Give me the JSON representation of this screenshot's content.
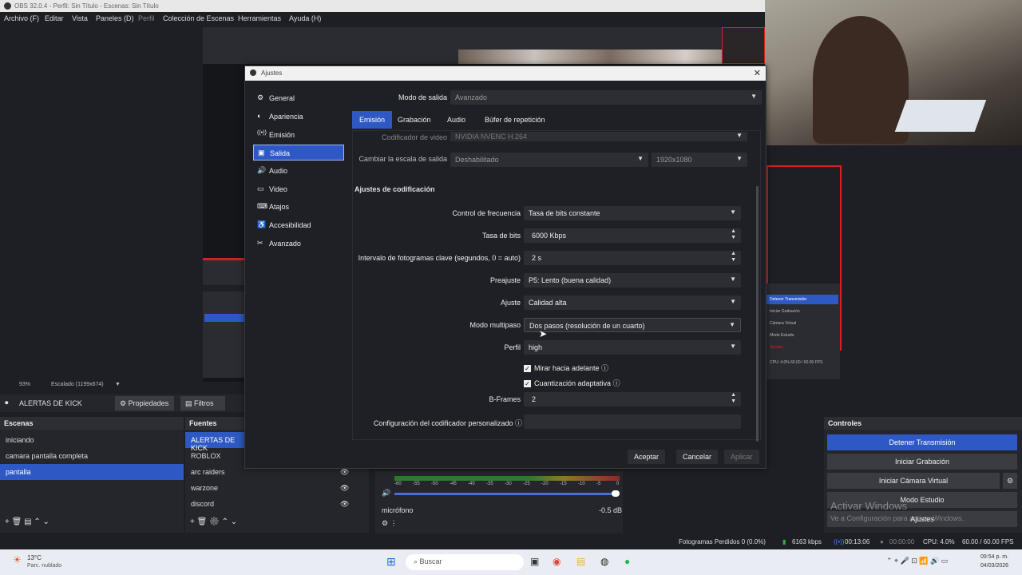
{
  "obs_window": {
    "title": "OBS 32.0.4 - Perfil: Sin Título - Escenas: Sin Título",
    "menu": [
      "Archivo (F)",
      "Editar",
      "Vista",
      "Paneles (D)",
      "Perfil",
      "Colección de Escenas",
      "Herramientas",
      "Ayuda (H)"
    ]
  },
  "preview_status": {
    "zoom": "93%",
    "scaling": "Escalado (1199x674)"
  },
  "source_toolbar": {
    "selected_source": "ALERTAS DE KICK",
    "properties": "Propiedades",
    "filters": "Filtros"
  },
  "scenes": {
    "title": "Escenas",
    "items": [
      "iniciando",
      "camara pantalla completa",
      "pantalla"
    ],
    "selected": 2
  },
  "sources": {
    "title": "Fuentes",
    "items": [
      "ALERTAS DE KICK",
      "ROBLOX",
      "arc raiders",
      "warzone",
      "discord"
    ]
  },
  "mixer": {
    "channel": "micrófono",
    "db": "-0.5 dB",
    "scale": [
      "-60",
      "-55",
      "-50",
      "-45",
      "-40",
      "-35",
      "-30",
      "-25",
      "-20",
      "-15",
      "-10",
      "-5",
      "0"
    ]
  },
  "controls": {
    "title": "Controles",
    "buttons": [
      "Detener Transmisión",
      "Iniciar Grabación",
      "Iniciar Cámara Virtual",
      "Modo Estudio",
      "Ajustes"
    ]
  },
  "watermark": {
    "line1": "Activar Windows",
    "line2": "Ve a Configuración para activar Windows."
  },
  "status_bar": {
    "dropped": "Fotogramas Perdidos 0 (0.0%)",
    "bitrate": "6163 kbps",
    "stream_time": "00:13:06",
    "rec_time": "00:00:00",
    "cpu": "CPU: 4.0%",
    "fps": "60.00 / 60.00 FPS"
  },
  "taskbar": {
    "weather_temp": "13°C",
    "weather_desc": "Parc. nublado",
    "search": "Buscar",
    "time": "09:54 p. m.",
    "date": "04/03/2026"
  },
  "nested_panel": {
    "items": [
      "Detener Transmisión",
      "Iniciar Grabación",
      "Cámara Virtual",
      "Modo Estudio",
      "Ajustes"
    ],
    "status": "CPU: 4.0%   60.00 / 60.00 FPS"
  },
  "settings": {
    "title": "Ajustes",
    "sidebar": [
      "General",
      "Apariencia",
      "Emisión",
      "Salida",
      "Audio",
      "Video",
      "Atajos",
      "Accesibilidad",
      "Avanzado"
    ],
    "sidebar_icons": [
      "⚙",
      "◐",
      "((•))",
      "▣",
      "🔊",
      "▭",
      "⌨",
      "♿",
      "✂"
    ],
    "selected": 3,
    "output_mode_label": "Modo de salida",
    "output_mode_value": "Avanzado",
    "tabs": [
      "Emisión",
      "Grabación",
      "Audio",
      "Búfer de repetición"
    ],
    "selected_tab": 0,
    "encoder_label": "Codificador de video",
    "encoder_value": "NVIDIA NVENC H.264",
    "rescale_label": "Cambiar la escala de salida",
    "rescale_value": "Deshabilitado",
    "rescale_res": "1920x1080",
    "section_title": "Ajustes de codificación",
    "rate_control_label": "Control de frecuencia",
    "rate_control_value": "Tasa de bits constante",
    "bitrate_label": "Tasa de bits",
    "bitrate_value": "6000 Kbps",
    "keyframe_label": "Intervalo de fotogramas clave (segundos, 0 = auto)",
    "keyframe_value": "2 s",
    "preset_label": "Preajuste",
    "preset_value": "P5: Lento (buena calidad)",
    "tuning_label": "Ajuste",
    "tuning_value": "Calidad alta",
    "multipass_label": "Modo multipaso",
    "multipass_value": "Dos pasos (resolución de un cuarto)",
    "profile_label": "Perfil",
    "profile_value": "high",
    "lookahead_label": "Mirar hacia adelante",
    "aq_label": "Cuantización adaptativa",
    "bframes_label": "B-Frames",
    "bframes_value": "2",
    "custom_label": "Configuración del codificador personalizado",
    "custom_value": "",
    "ok": "Aceptar",
    "cancel": "Cancelar",
    "apply": "Aplicar"
  }
}
